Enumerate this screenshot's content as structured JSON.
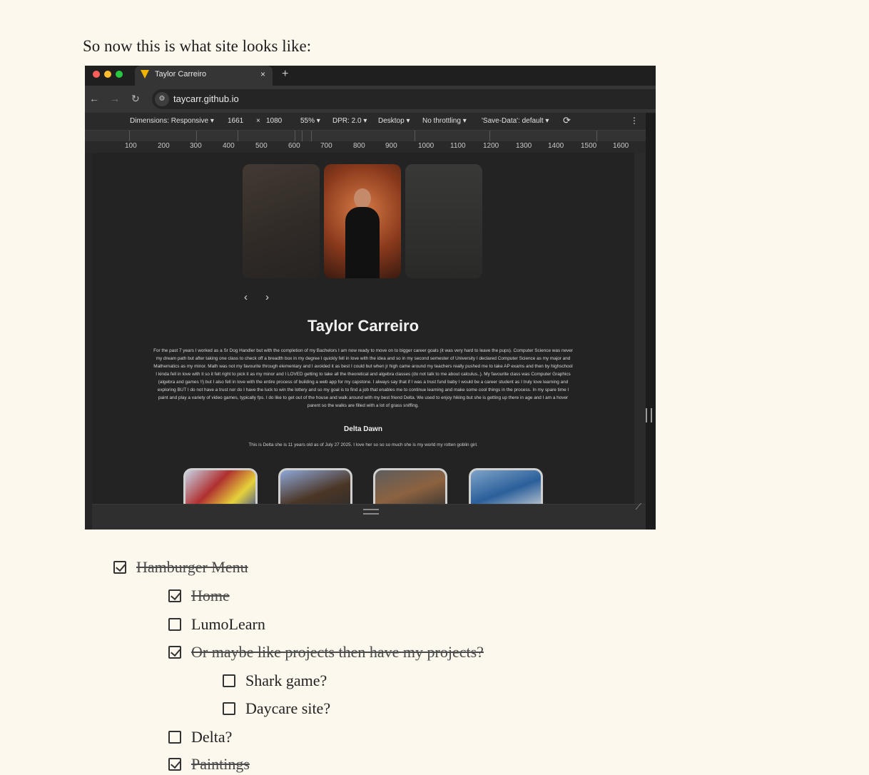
{
  "intro": "So now this is what site looks like:",
  "browser": {
    "tab_title": "Taylor Carreiro",
    "tab_close": "×",
    "new_tab": "+",
    "url": "taycarr.github.io",
    "devtools": {
      "dimensions": "Dimensions: Responsive ▾",
      "width": "1661",
      "times": "×",
      "height": "1080",
      "zoom": "55% ▾",
      "dpr": "DPR: 2.0 ▾",
      "device": "Desktop ▾",
      "throttling": "No throttling ▾",
      "save_data": "'Save-Data': default ▾",
      "more": "⋮"
    },
    "ruler_ticks": [
      "100",
      "200",
      "300",
      "400",
      "500",
      "600",
      "700",
      "800",
      "900",
      "1000",
      "1100",
      "1200",
      "1300",
      "1400",
      "1500",
      "1600"
    ]
  },
  "site": {
    "prev": "‹",
    "next": "›",
    "name": "Taylor Carreiro",
    "bio": "For the past 7 years I worked as a Sr Dog Handler but with the completion of my Bachelors I am now ready to move on to bigger career goals (it was very hard to leave the pups). Computer Science was never my dream path but after taking one class to check off a breadth box in my degree I quickly fell in love with the idea and so in my second semester of University I declared Computer Science as my major and Mathematics as my minor. Math was not my favourite through elementary and I avoided it as best I could but when jr high came around my teachers really pushed me to take AP exams and then by highschool I kinda fell in love with it so it felt right to pick it as my minor and I LOVED getting to take all the theoretical and algebra classes (do not talk to me about calculus..). My favourite class was Computer Graphics (algebra and games !!) but I also fell in love with the entire process of building a web app for my capstone. I always say that if I was a trust fund baby I would be a career student as I truly love learning and exploring BUT I do not have a trust nor do I have the luck to win the lottery and so my goal is to find a job that enables me to continue learning and make some cool things in the process. In my spare time I paint and play a variety of video games, typically fps. I do like to get out of the house and walk around with my best friend Delta. We used to enjoy hiking but she is getting up there in age and I am a hover parent so the walks are filled with a lot of grass sniffing.",
    "pet_heading": "Delta Dawn",
    "pet_desc": "This is Delta she is 11 years old as of July 27 2025. I love her so so so much she is my world my rotten goblin girl."
  },
  "checklist": [
    {
      "label": "Hamburger Menu",
      "checked": true
    },
    {
      "label": "Home",
      "checked": true
    },
    {
      "label": "LumoLearn",
      "checked": false
    },
    {
      "label": "Or maybe like projects then have my projects?",
      "checked": true
    },
    {
      "label": "Shark game?",
      "checked": false
    },
    {
      "label": "Daycare site?",
      "checked": false
    },
    {
      "label": "Delta?",
      "checked": false
    },
    {
      "label": "Paintings",
      "checked": true
    }
  ]
}
